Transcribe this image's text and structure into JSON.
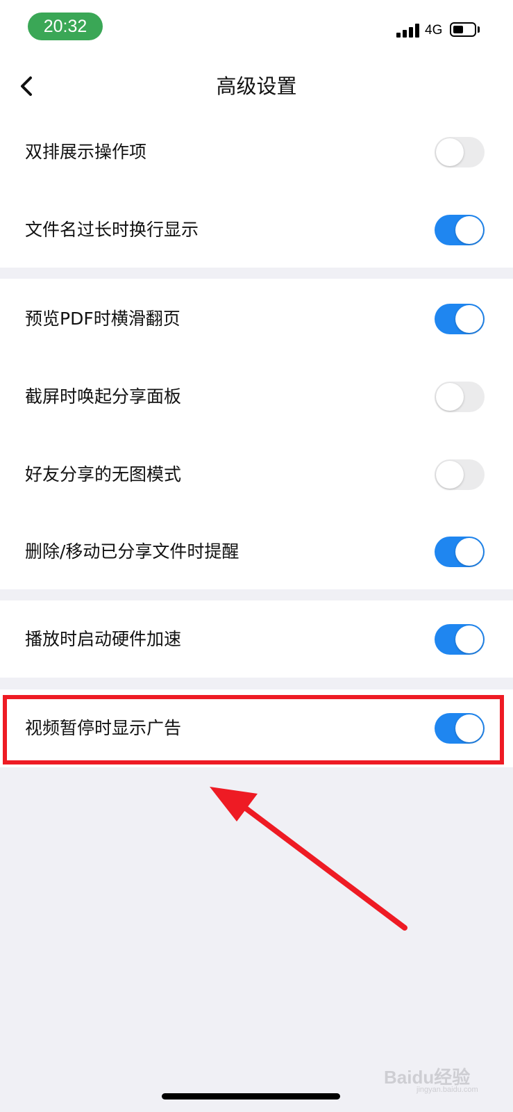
{
  "status_bar": {
    "time": "20:32",
    "network": "4G"
  },
  "header": {
    "title": "高级设置"
  },
  "settings": [
    {
      "label": "双排展示操作项",
      "on": false
    },
    {
      "label": "文件名过长时换行显示",
      "on": true
    },
    {
      "label": "预览PDF时横滑翻页",
      "on": true
    },
    {
      "label": "截屏时唤起分享面板",
      "on": false
    },
    {
      "label": "好友分享的无图模式",
      "on": false
    },
    {
      "label": "删除/移动已分享文件时提醒",
      "on": true
    },
    {
      "label": "播放时启动硬件加速",
      "on": true
    },
    {
      "label": "视频暂停时显示广告",
      "on": true
    }
  ],
  "watermark": {
    "text": "Baidu经验",
    "sub": "jingyan.baidu.com"
  },
  "colors": {
    "accent": "#1f86f0",
    "highlight": "#ee1b24",
    "time_badge": "#3aa756",
    "background": "#f0f0f5"
  }
}
